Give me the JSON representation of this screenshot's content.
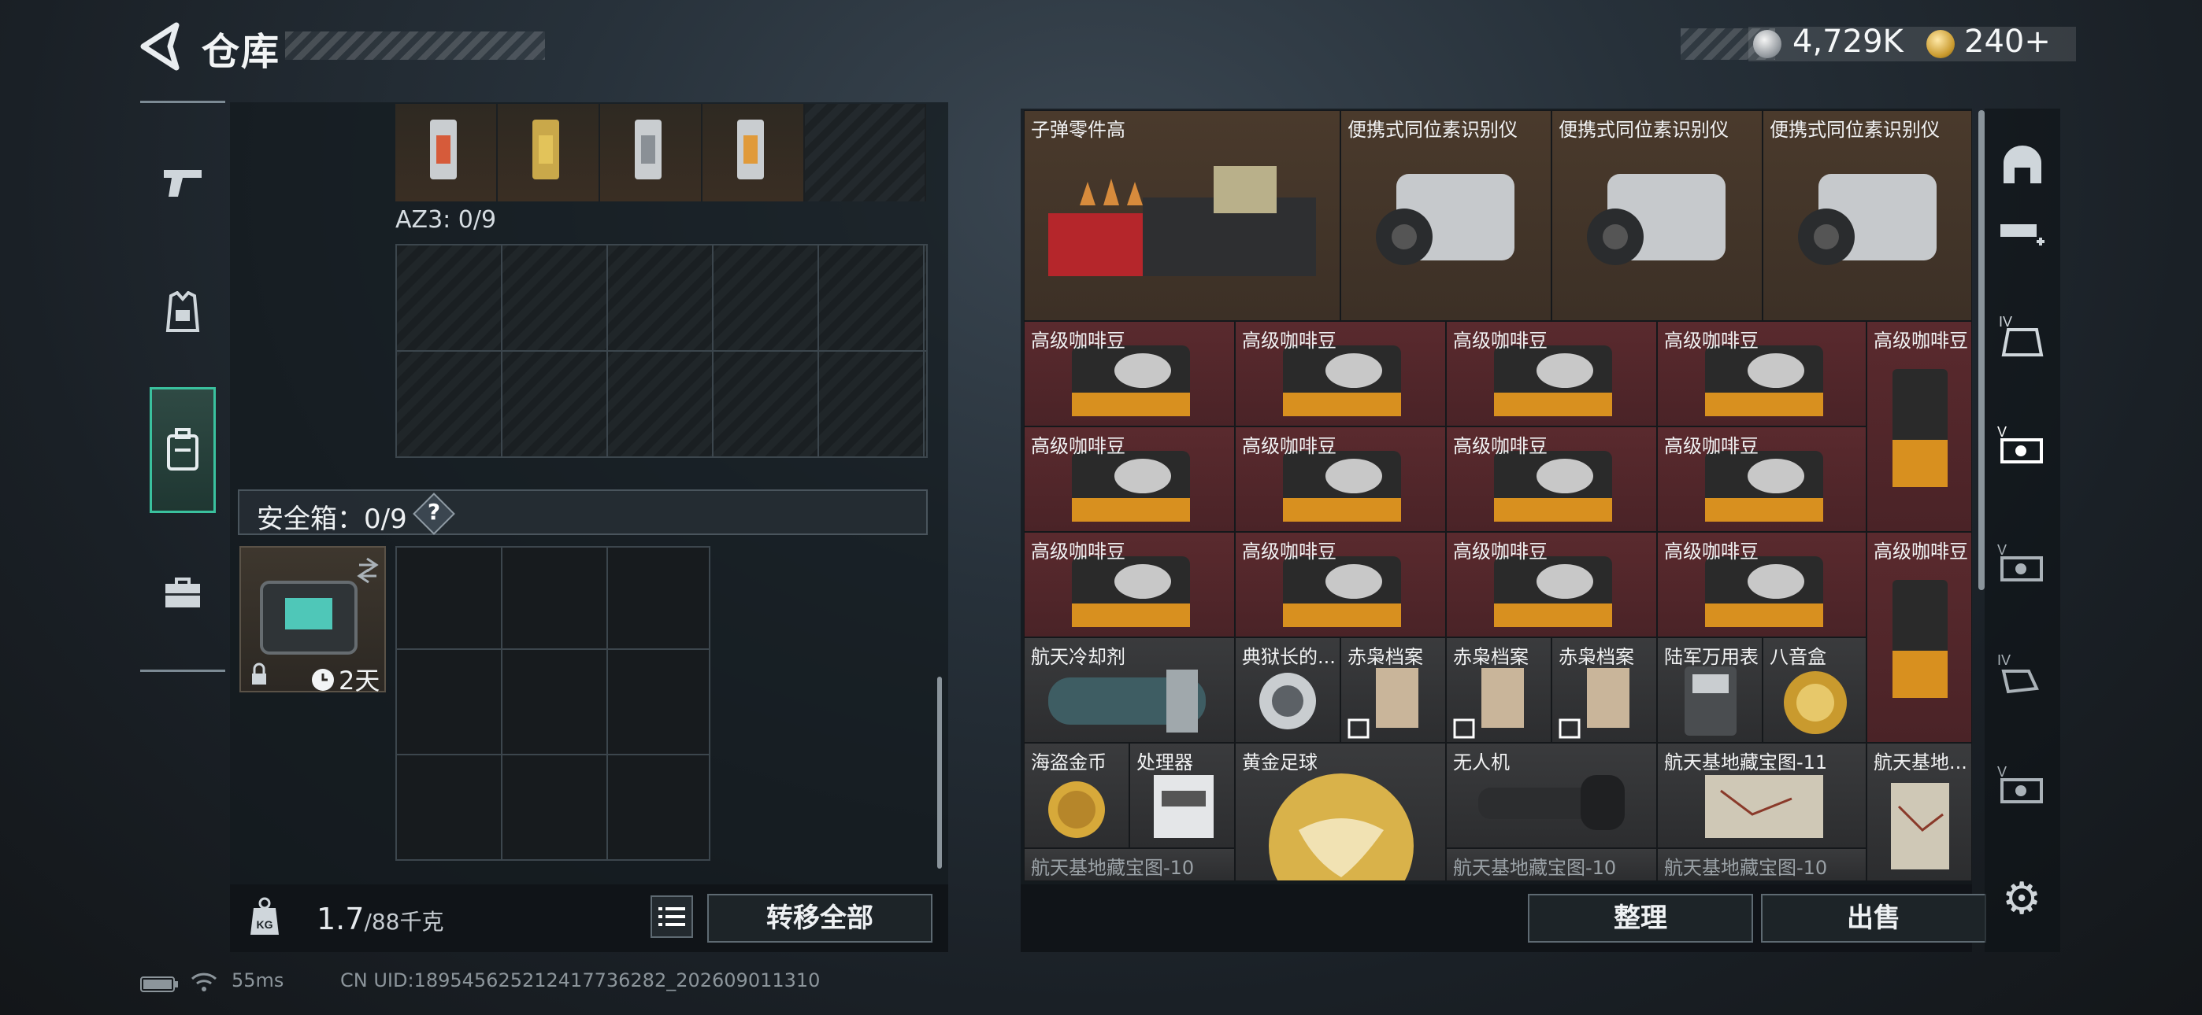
{
  "header": {
    "title": "仓库",
    "back_icon": "back-arrow-icon",
    "currency": [
      {
        "icon": "silver-coin-icon",
        "amount": "4,729K"
      },
      {
        "icon": "gold-coin-icon",
        "amount": "240+"
      }
    ]
  },
  "left_tabs": [
    {
      "name": "weapons",
      "icon": "pistol-icon",
      "active": false
    },
    {
      "name": "armor",
      "icon": "vest-icon",
      "active": false
    },
    {
      "name": "backpack",
      "icon": "backpack-icon",
      "active": true
    },
    {
      "name": "kit",
      "icon": "briefcase-icon",
      "active": false
    }
  ],
  "loadout": {
    "az3_label": "AZ3: 0/9",
    "safe_label": "安全箱：0/9",
    "help": "?",
    "case_timer": "2天"
  },
  "left_footer": {
    "weight_value": "1.7",
    "weight_capacity": "/88千克",
    "transfer_all": "转移全部"
  },
  "stash_items": {
    "row1": [
      "子弹零件高",
      "便携式同位素识别仪",
      "便携式同位素识别仪",
      "便携式同位素识别仪"
    ],
    "coffee": "高级咖啡豆",
    "row5": [
      "航天冷却剂",
      "典狱长的...",
      "赤枭档案",
      "赤枭档案",
      "赤枭档案",
      "陆军万用表",
      "八音盒"
    ],
    "row6": [
      "海盗金币",
      "处理器",
      "黄金足球",
      "无人机",
      "航天基地藏宝图-11",
      "航天基地..."
    ],
    "row7": [
      "航天基地藏宝图-10",
      "航天基地藏宝图-10",
      "航天基地藏宝图-10"
    ]
  },
  "stash_footer": {
    "sort": "整理",
    "sell": "出售"
  },
  "categories": [
    "helmet-icon",
    "ammo-icon",
    "tier4-armor-icon",
    "tier5-gear-icon",
    "tier5-item-icon",
    "tier4-item-icon",
    "tier5-misc-icon"
  ],
  "footer": {
    "ping": "55ms",
    "uid": "CN UID:1895456252124177362​82_202609011310"
  }
}
